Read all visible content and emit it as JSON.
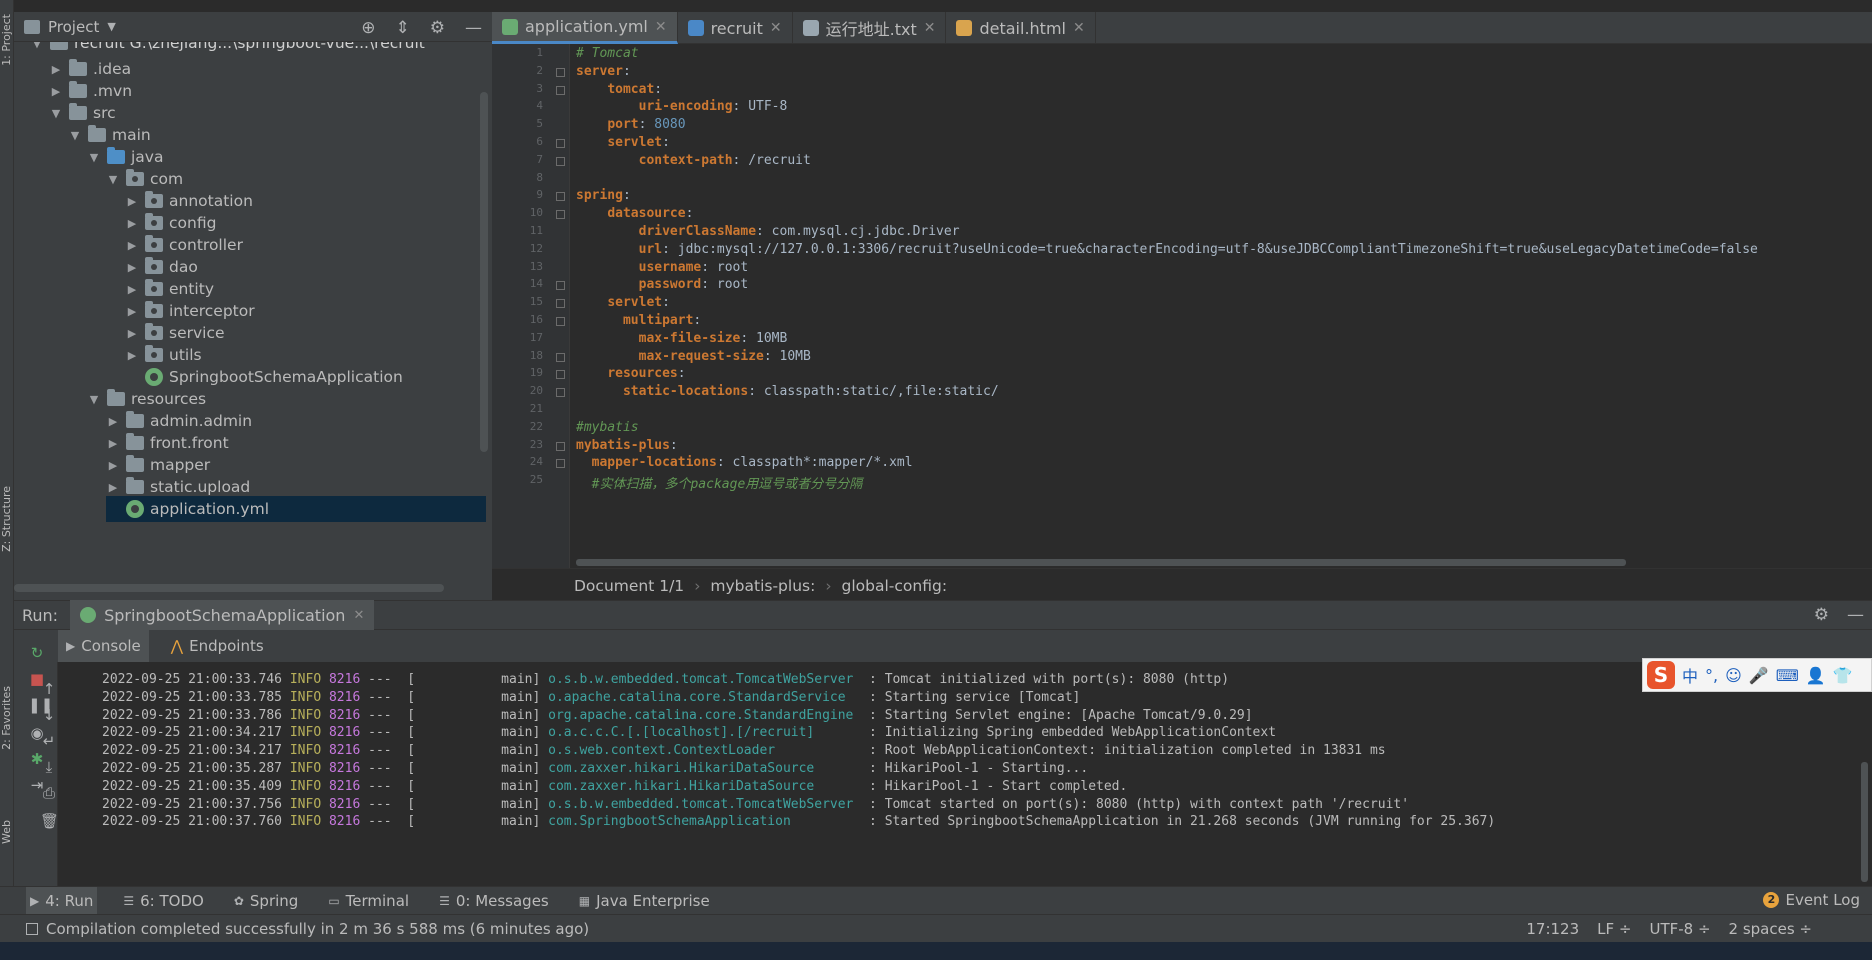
{
  "left_strip": {
    "project": "1: Project",
    "structure": "Z: Structure",
    "favorites": "2: Favorites",
    "web": "Web"
  },
  "project_panel": {
    "title": "Project",
    "root_partial": "recruit  G:\\zhejiang...\\springboot-vue...\\recruit",
    "items": [
      {
        "label": ".idea",
        "depth": 1,
        "kind": "folder",
        "arrow": "right"
      },
      {
        "label": ".mvn",
        "depth": 1,
        "kind": "folder",
        "arrow": "right"
      },
      {
        "label": "src",
        "depth": 1,
        "kind": "folder",
        "arrow": "down"
      },
      {
        "label": "main",
        "depth": 2,
        "kind": "folder",
        "arrow": "down"
      },
      {
        "label": "java",
        "depth": 3,
        "kind": "folder-blue",
        "arrow": "down"
      },
      {
        "label": "com",
        "depth": 4,
        "kind": "package",
        "arrow": "down"
      },
      {
        "label": "annotation",
        "depth": 5,
        "kind": "package",
        "arrow": "right"
      },
      {
        "label": "config",
        "depth": 5,
        "kind": "package",
        "arrow": "right"
      },
      {
        "label": "controller",
        "depth": 5,
        "kind": "package",
        "arrow": "right"
      },
      {
        "label": "dao",
        "depth": 5,
        "kind": "package",
        "arrow": "right"
      },
      {
        "label": "entity",
        "depth": 5,
        "kind": "package",
        "arrow": "right"
      },
      {
        "label": "interceptor",
        "depth": 5,
        "kind": "package",
        "arrow": "right"
      },
      {
        "label": "service",
        "depth": 5,
        "kind": "package",
        "arrow": "right"
      },
      {
        "label": "utils",
        "depth": 5,
        "kind": "package",
        "arrow": "right"
      },
      {
        "label": "SpringbootSchemaApplication",
        "depth": 5,
        "kind": "spring",
        "arrow": "none"
      },
      {
        "label": "resources",
        "depth": 3,
        "kind": "folder-res",
        "arrow": "down"
      },
      {
        "label": "admin.admin",
        "depth": 4,
        "kind": "folder",
        "arrow": "right"
      },
      {
        "label": "front.front",
        "depth": 4,
        "kind": "folder",
        "arrow": "right"
      },
      {
        "label": "mapper",
        "depth": 4,
        "kind": "folder",
        "arrow": "right"
      },
      {
        "label": "static.upload",
        "depth": 4,
        "kind": "folder",
        "arrow": "right"
      },
      {
        "label": "application.yml",
        "depth": 4,
        "kind": "spring",
        "arrow": "none"
      }
    ]
  },
  "tabs": [
    {
      "label": "application.yml",
      "active": true,
      "icon_color": "#6aab73"
    },
    {
      "label": "recruit",
      "active": false,
      "icon_color": "#4a88c7"
    },
    {
      "label": "运行地址.txt",
      "active": false,
      "icon_color": "#9aa7b0"
    },
    {
      "label": "detail.html",
      "active": false,
      "icon_color": "#d9a44e"
    }
  ],
  "editor": {
    "lines": [
      {
        "n": "1",
        "parts": [
          [
            "cm",
            "# Tomcat"
          ]
        ]
      },
      {
        "n": "2",
        "parts": [
          [
            "k",
            "server"
          ],
          [
            "s",
            ":"
          ]
        ]
      },
      {
        "n": "3",
        "parts": [
          [
            "s",
            "    "
          ],
          [
            "k",
            "tomcat"
          ],
          [
            "s",
            ":"
          ]
        ]
      },
      {
        "n": "4",
        "parts": [
          [
            "s",
            "        "
          ],
          [
            "k",
            "uri-encoding"
          ],
          [
            "s",
            ": UTF-8"
          ]
        ]
      },
      {
        "n": "5",
        "parts": [
          [
            "s",
            "    "
          ],
          [
            "k",
            "port"
          ],
          [
            "s",
            ": "
          ],
          [
            "num",
            "8080"
          ]
        ]
      },
      {
        "n": "6",
        "parts": [
          [
            "s",
            "    "
          ],
          [
            "k",
            "servlet"
          ],
          [
            "s",
            ":"
          ]
        ]
      },
      {
        "n": "7",
        "parts": [
          [
            "s",
            "        "
          ],
          [
            "k",
            "context-path"
          ],
          [
            "s",
            ": /recruit"
          ]
        ]
      },
      {
        "n": "8",
        "parts": []
      },
      {
        "n": "9",
        "parts": [
          [
            "k",
            "spring"
          ],
          [
            "s",
            ":"
          ]
        ]
      },
      {
        "n": "10",
        "parts": [
          [
            "s",
            "    "
          ],
          [
            "k",
            "datasource"
          ],
          [
            "s",
            ":"
          ]
        ]
      },
      {
        "n": "11",
        "parts": [
          [
            "s",
            "        "
          ],
          [
            "k",
            "driverClassName"
          ],
          [
            "s",
            ": com.mysql.cj.jdbc.Driver"
          ]
        ]
      },
      {
        "n": "12",
        "parts": [
          [
            "s",
            "        "
          ],
          [
            "k",
            "url"
          ],
          [
            "s",
            ": jdbc:mysql://127.0.0.1:3306/recruit?useUnicode=true&characterEncoding=utf-8&useJDBCCompliantTimezoneShift=true&useLegacyDatetimeCode=false"
          ]
        ]
      },
      {
        "n": "13",
        "parts": [
          [
            "s",
            "        "
          ],
          [
            "k",
            "username"
          ],
          [
            "s",
            ": root"
          ]
        ]
      },
      {
        "n": "14",
        "parts": [
          [
            "s",
            "        "
          ],
          [
            "k",
            "password"
          ],
          [
            "s",
            ": root"
          ]
        ]
      },
      {
        "n": "15",
        "parts": [
          [
            "s",
            "    "
          ],
          [
            "k",
            "servlet"
          ],
          [
            "s",
            ":"
          ]
        ]
      },
      {
        "n": "16",
        "parts": [
          [
            "s",
            "      "
          ],
          [
            "k",
            "multipart"
          ],
          [
            "s",
            ":"
          ]
        ]
      },
      {
        "n": "17",
        "parts": [
          [
            "s",
            "        "
          ],
          [
            "k",
            "max-file-size"
          ],
          [
            "s",
            ": 10MB"
          ]
        ]
      },
      {
        "n": "18",
        "parts": [
          [
            "s",
            "        "
          ],
          [
            "k",
            "max-request-size"
          ],
          [
            "s",
            ": 10MB"
          ]
        ]
      },
      {
        "n": "19",
        "parts": [
          [
            "s",
            "    "
          ],
          [
            "k",
            "resources"
          ],
          [
            "s",
            ":"
          ]
        ]
      },
      {
        "n": "20",
        "parts": [
          [
            "s",
            "      "
          ],
          [
            "k",
            "static-locations"
          ],
          [
            "s",
            ": classpath:static/,file:static/"
          ]
        ]
      },
      {
        "n": "21",
        "parts": []
      },
      {
        "n": "22",
        "parts": [
          [
            "cm",
            "#mybatis"
          ]
        ]
      },
      {
        "n": "23",
        "parts": [
          [
            "k",
            "mybatis-plus"
          ],
          [
            "s",
            ":"
          ]
        ]
      },
      {
        "n": "24",
        "parts": [
          [
            "s",
            "  "
          ],
          [
            "k",
            "mapper-locations"
          ],
          [
            "s",
            ": classpath*:mapper/*.xml"
          ]
        ]
      },
      {
        "n": "25",
        "parts": [
          [
            "cm",
            "  #实体扫描，多个package用逗号或者分号分隔"
          ]
        ]
      }
    ]
  },
  "breadcrumb": [
    "Document 1/1",
    "mybatis-plus:",
    "global-config:"
  ],
  "run_panel": {
    "label": "Run:",
    "config": "SpringbootSchemaApplication",
    "subtabs": [
      "Console",
      "Endpoints"
    ],
    "logs": [
      {
        "ts": "2022-09-25 21:00:33.746",
        "lvl": "INFO",
        "pid": "8216",
        "thread": "---  [           main]",
        "cls": "o.s.b.w.embedded.tomcat.TomcatWebServer ",
        "msg": ": Tomcat initialized with port(s): 8080 (http)"
      },
      {
        "ts": "2022-09-25 21:00:33.785",
        "lvl": "INFO",
        "pid": "8216",
        "thread": "---  [           main]",
        "cls": "o.apache.catalina.core.StandardService  ",
        "msg": ": Starting service [Tomcat]"
      },
      {
        "ts": "2022-09-25 21:00:33.786",
        "lvl": "INFO",
        "pid": "8216",
        "thread": "---  [           main]",
        "cls": "org.apache.catalina.core.StandardEngine ",
        "msg": ": Starting Servlet engine: [Apache Tomcat/9.0.29]"
      },
      {
        "ts": "2022-09-25 21:00:34.217",
        "lvl": "INFO",
        "pid": "8216",
        "thread": "---  [           main]",
        "cls": "o.a.c.c.C.[.[localhost].[/recruit]      ",
        "msg": ": Initializing Spring embedded WebApplicationContext"
      },
      {
        "ts": "2022-09-25 21:00:34.217",
        "lvl": "INFO",
        "pid": "8216",
        "thread": "---  [           main]",
        "cls": "o.s.web.context.ContextLoader           ",
        "msg": ": Root WebApplicationContext: initialization completed in 13831 ms"
      },
      {
        "ts": "2022-09-25 21:00:35.287",
        "lvl": "INFO",
        "pid": "8216",
        "thread": "---  [           main]",
        "cls": "com.zaxxer.hikari.HikariDataSource      ",
        "msg": ": HikariPool-1 - Starting..."
      },
      {
        "ts": "2022-09-25 21:00:35.409",
        "lvl": "INFO",
        "pid": "8216",
        "thread": "---  [           main]",
        "cls": "com.zaxxer.hikari.HikariDataSource      ",
        "msg": ": HikariPool-1 - Start completed."
      },
      {
        "ts": "2022-09-25 21:00:37.756",
        "lvl": "INFO",
        "pid": "8216",
        "thread": "---  [           main]",
        "cls": "o.s.b.w.embedded.tomcat.TomcatWebServer ",
        "msg": ": Tomcat started on port(s): 8080 (http) with context path '/recruit'"
      },
      {
        "ts": "2022-09-25 21:00:37.760",
        "lvl": "INFO",
        "pid": "8216",
        "thread": "---  [           main]",
        "cls": "com.SpringbootSchemaApplication         ",
        "msg": ": Started SpringbootSchemaApplication in 21.268 seconds (JVM running for 25.367)"
      }
    ]
  },
  "ime": {
    "logo": "S",
    "lang": "中",
    "punct": "°,"
  },
  "bottom_tabs": [
    {
      "label": "4: Run",
      "icon": "▶",
      "active": true
    },
    {
      "label": "6: TODO",
      "icon": "☰",
      "active": false
    },
    {
      "label": "Spring",
      "icon": "✿",
      "active": false
    },
    {
      "label": "Terminal",
      "icon": "▭",
      "active": false
    },
    {
      "label": "0: Messages",
      "icon": "☰",
      "active": false
    },
    {
      "label": "Java Enterprise",
      "icon": "▦",
      "active": false
    }
  ],
  "event_log": {
    "count": "2",
    "label": "Event Log"
  },
  "status": {
    "message": "Compilation completed successfully in 2 m 36 s 588 ms (6 minutes ago)",
    "position": "17:123",
    "line_sep": "LF ÷",
    "encoding": "UTF-8 ÷",
    "indent": "2 spaces ÷"
  }
}
